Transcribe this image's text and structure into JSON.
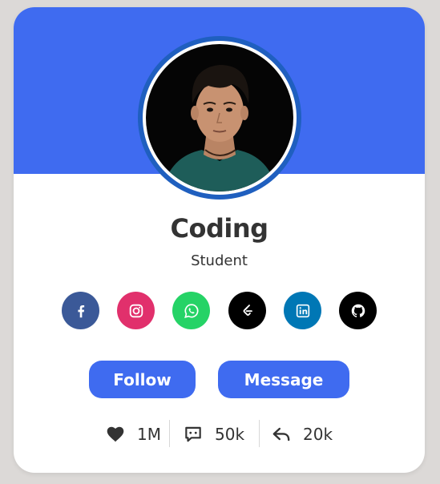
{
  "profile": {
    "name": "Coding",
    "role": "Student"
  },
  "colors": {
    "cover": "#3f6bf0",
    "button": "#3f6bf0",
    "ring": "#1f5fbf",
    "text": "#333333"
  },
  "socials": [
    {
      "name": "facebook-icon",
      "color": "#3b5998"
    },
    {
      "name": "instagram-icon",
      "color": "#e1306c"
    },
    {
      "name": "whatsapp-icon",
      "color": "#25d366"
    },
    {
      "name": "leetcode-icon",
      "color": "#000000"
    },
    {
      "name": "linkedin-icon",
      "color": "#0077b5"
    },
    {
      "name": "github-icon",
      "color": "#000000"
    }
  ],
  "buttons": {
    "follow": "Follow",
    "message": "Message"
  },
  "stats": {
    "likes": "1M",
    "comments": "50k",
    "shares": "20k"
  }
}
